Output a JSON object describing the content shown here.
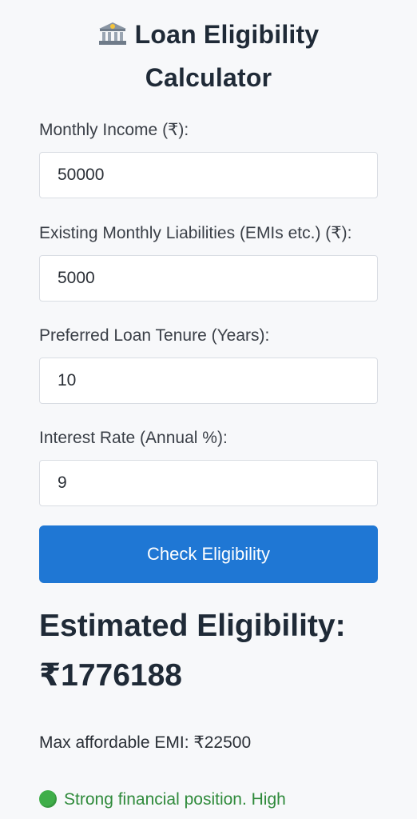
{
  "header": {
    "icon": "bank-icon",
    "title": "Loan Eligibility Calculator"
  },
  "form": {
    "income": {
      "label": "Monthly Income (₹):",
      "value": "50000"
    },
    "liabilities": {
      "label": "Existing Monthly Liabilities (EMIs etc.) (₹):",
      "value": "5000"
    },
    "tenure": {
      "label": "Preferred Loan Tenure (Years):",
      "value": "10"
    },
    "interest": {
      "label": "Interest Rate (Annual %):",
      "value": "9"
    },
    "submit_label": "Check Eligibility"
  },
  "result": {
    "heading": "Estimated Eligibility:",
    "amount": "₹1776188",
    "max_emi": "Max affordable EMI: ₹22500",
    "status_icon": "green-circle-icon",
    "status_text": "Strong financial position. High"
  },
  "colors": {
    "accent": "#1f77d4",
    "success": "#2f8a3b",
    "background": "#f7f8fa"
  }
}
